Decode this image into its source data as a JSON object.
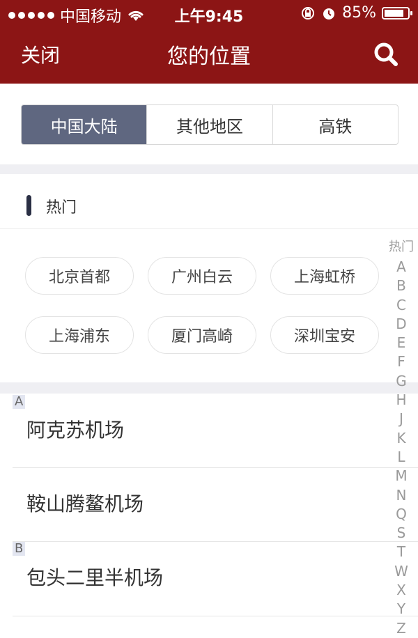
{
  "status": {
    "carrier": "中国移动",
    "time": "上午9:45",
    "battery": "85%",
    "battery_level": 0.85
  },
  "nav": {
    "close_label": "关闭",
    "title": "您的位置"
  },
  "segments": [
    "中国大陆",
    "其他地区",
    "高铁"
  ],
  "active_segment": 0,
  "hot": {
    "label": "热门",
    "airports": [
      "北京首都",
      "广州白云",
      "上海虹桥",
      "上海浦东",
      "厦门高崎",
      "深圳宝安"
    ]
  },
  "sections": [
    {
      "letter": "A",
      "airports": [
        "阿克苏机场",
        "鞍山腾鳌机场"
      ]
    },
    {
      "letter": "B",
      "airports": [
        "包头二里半机场"
      ]
    }
  ],
  "index": [
    "热门",
    "A",
    "B",
    "C",
    "D",
    "E",
    "F",
    "G",
    "H",
    "J",
    "K",
    "L",
    "M",
    "N",
    "Q",
    "S",
    "T",
    "W",
    "X",
    "Y",
    "Z"
  ],
  "colors": {
    "header_bg": "#8c1515",
    "active_segment_bg": "#5f6780",
    "hot_bar": "#2a2f44",
    "band_bg": "#efeff3"
  }
}
